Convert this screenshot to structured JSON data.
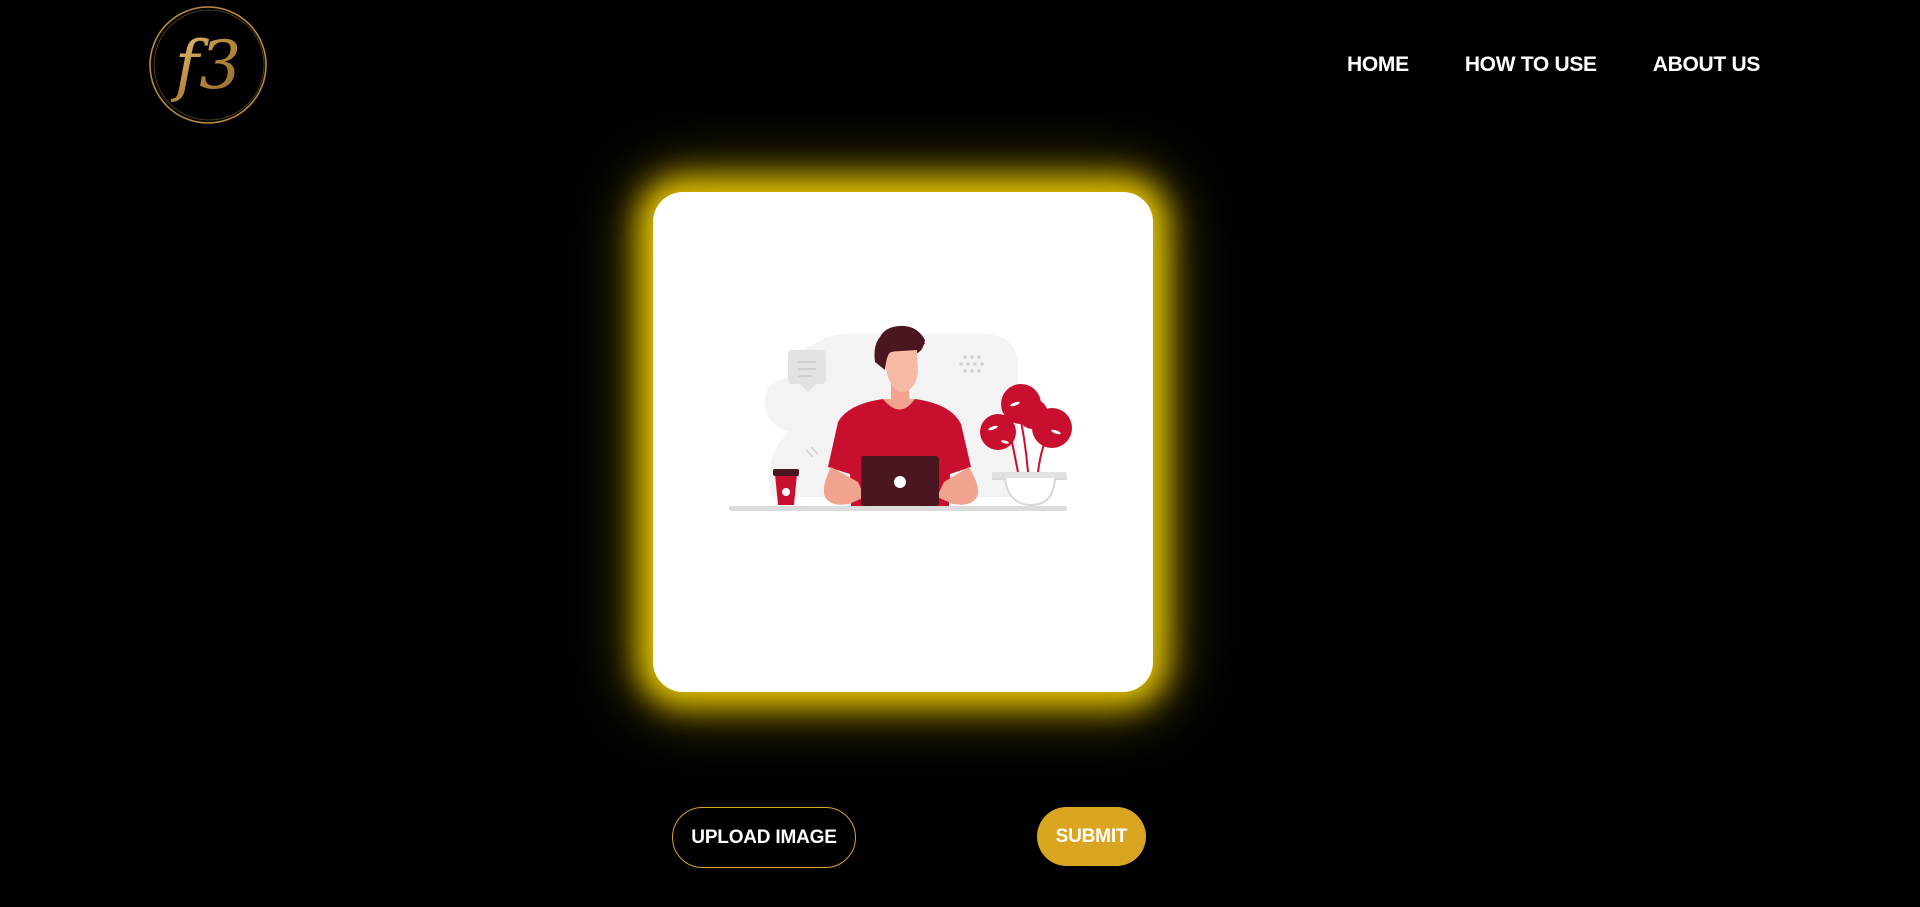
{
  "header": {
    "logo_text": "f3",
    "nav": [
      {
        "label": "HOME"
      },
      {
        "label": "HOW TO USE"
      },
      {
        "label": "ABOUT US"
      }
    ]
  },
  "main": {
    "illustration": "person-working-on-laptop-illustration"
  },
  "actions": {
    "upload_label": "UPLOAD IMAGE",
    "submit_label": "SUBMIT"
  },
  "colors": {
    "background": "#000000",
    "accent_gold": "#daa520",
    "glow": "#ebc800",
    "illustration_red": "#c8102e"
  }
}
